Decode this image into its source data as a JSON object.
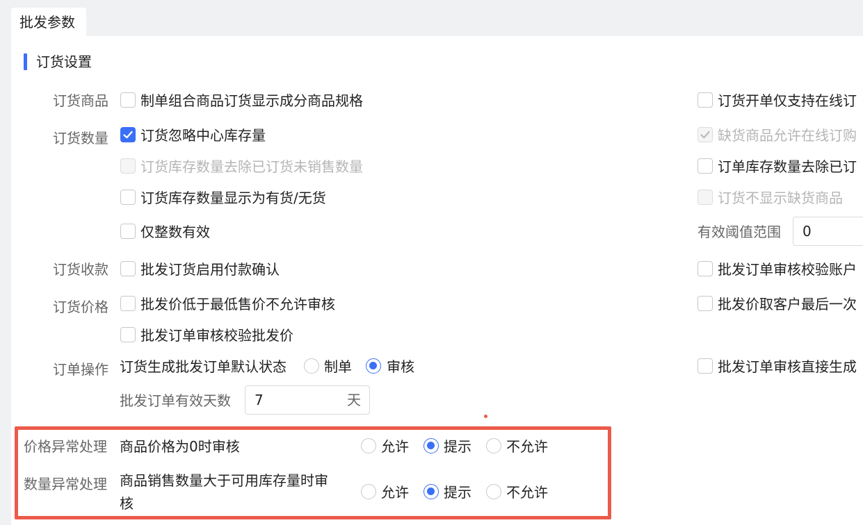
{
  "tab": {
    "label": "批发参数"
  },
  "section": {
    "title": "订货设置"
  },
  "rows": {
    "goods": {
      "label": "订货商品",
      "left": {
        "text": "制单组合商品订货显示成分商品规格",
        "checked": false
      },
      "right": {
        "text": "订货开单仅支持在线订",
        "checked": false
      }
    },
    "qty": {
      "label": "订货数量",
      "items": [
        {
          "text": "订货忽略中心库存量",
          "checked": true,
          "disabled": false
        },
        {
          "text": "订货库存数量去除已订货未销售数量",
          "checked": false,
          "disabled": true
        },
        {
          "text": "订货库存数量显示为有货/无货",
          "checked": false,
          "disabled": false
        },
        {
          "text": "仅整数有效",
          "checked": false,
          "disabled": false
        }
      ],
      "right": [
        {
          "text": "缺货商品允许在线订购",
          "checked": true,
          "disabled": true
        },
        {
          "text": "订单库存数量去除已订",
          "checked": false,
          "disabled": false
        },
        {
          "text": "订货不显示缺货商品",
          "checked": false,
          "disabled": true
        }
      ],
      "threshold": {
        "label": "有效阈值范围",
        "value": "0"
      }
    },
    "payment": {
      "label": "订货收款",
      "left": {
        "text": "批发订货启用付款确认",
        "checked": false
      },
      "right": {
        "text": "批发订单审核校验账户",
        "checked": false
      }
    },
    "price": {
      "label": "订货价格",
      "items": [
        {
          "text": "批发价低于最低售价不允许审核",
          "checked": false
        },
        {
          "text": "批发订单审核校验批发价",
          "checked": false
        }
      ],
      "right": {
        "text": "批发价取客户最后一次",
        "checked": false
      }
    },
    "operation": {
      "label": "订单操作",
      "default_status_label": "订货生成批发订单默认状态",
      "options": [
        "制单",
        "审核"
      ],
      "selected": "审核",
      "right": {
        "text": "批发订单审核直接生成",
        "checked": false
      },
      "valid_days": {
        "label": "批发订单有效天数",
        "value": "7",
        "unit": "天"
      }
    },
    "price_exception": {
      "label": "价格异常处理",
      "desc": "商品价格为0时审核",
      "options": [
        "允许",
        "提示",
        "不允许"
      ],
      "selected": "提示"
    },
    "qty_exception": {
      "label": "数量异常处理",
      "desc_line1": "商品销售数量大于可用库存量时审",
      "desc_line2": "核",
      "options": [
        "允许",
        "提示",
        "不允许"
      ],
      "selected": "提示"
    }
  },
  "colors": {
    "accent": "#3a6ff7",
    "highlight": "#ec5a4a"
  }
}
